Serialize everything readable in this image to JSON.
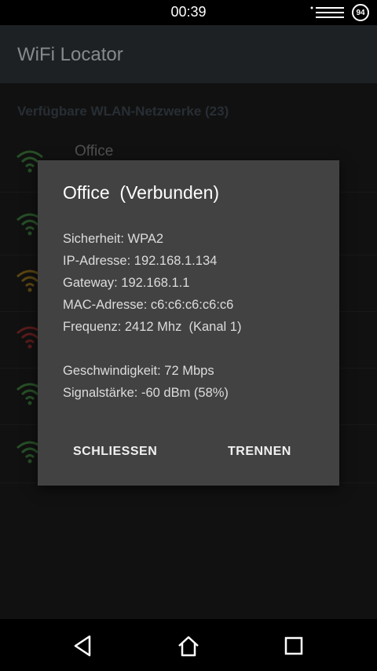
{
  "status_bar": {
    "time": "00:39",
    "battery": "94"
  },
  "app_bar": {
    "title": "WiFi Locator"
  },
  "list": {
    "header": "Verfügbare WLAN-Netzwerke (23)",
    "first_network_name": "Office",
    "signal_colors": [
      "#3c7a3c",
      "#3c7a3c",
      "#8a6a1c",
      "#8a2a2a",
      "#3c7a3c",
      "#3c7a3c"
    ]
  },
  "dialog": {
    "title": "Office  (Verbunden)",
    "security": "Sicherheit: WPA2",
    "ip": "IP-Adresse: 192.168.1.134",
    "gateway": "Gateway: 192.168.1.1",
    "mac": "MAC-Adresse: c6:c6:c6:c6:c6",
    "frequency": "Frequenz: 2412 Mhz  (Kanal 1)",
    "speed": "Geschwindigkeit: 72 Mbps",
    "signal": "Signalstärke: -60 dBm (58%)",
    "close_label": "SCHLIESSEN",
    "disconnect_label": "TRENNEN"
  },
  "nav_bar": {
    "icons": [
      "back-icon",
      "home-icon",
      "recents-icon"
    ]
  }
}
